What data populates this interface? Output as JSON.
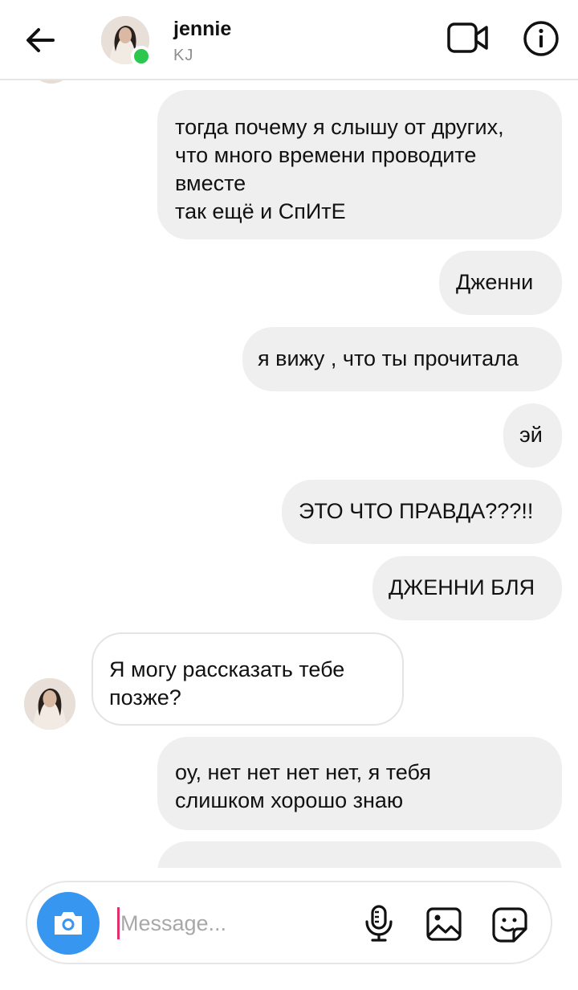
{
  "header": {
    "contact_name": "jennie",
    "contact_subtitle": "KJ",
    "status": "online",
    "icons": {
      "back": "arrow-left-icon",
      "video": "video-call-icon",
      "info": "info-icon"
    }
  },
  "messages": [
    {
      "sender": "me",
      "text": "тогда почему я слышу от других,\nчто много времени проводите\nвместе\nтак ещё и СпИтЕ"
    },
    {
      "sender": "me",
      "text": "Дженни"
    },
    {
      "sender": "me",
      "text": "я вижу , что ты прочитала"
    },
    {
      "sender": "me",
      "text": "эй"
    },
    {
      "sender": "me",
      "text": "ЭТО ЧТО ПРАВДА???!!"
    },
    {
      "sender": "me",
      "text": "ДЖЕННИ БЛЯ"
    },
    {
      "sender": "them",
      "text": "Я могу рассказать тебе\nпозже?"
    },
    {
      "sender": "me",
      "text": "оу, нет нет нет нет, я тебя\nслишком хорошо знаю"
    }
  ],
  "composer": {
    "placeholder": "Message...",
    "value": "",
    "icons": {
      "camera": "camera-icon",
      "mic": "microphone-icon",
      "gallery": "gallery-icon",
      "sticker": "sticker-icon"
    }
  },
  "colors": {
    "accent": "#3797f0",
    "online": "#2cc84d",
    "caret": "#e1306c",
    "my_bubble": "#efefef"
  }
}
